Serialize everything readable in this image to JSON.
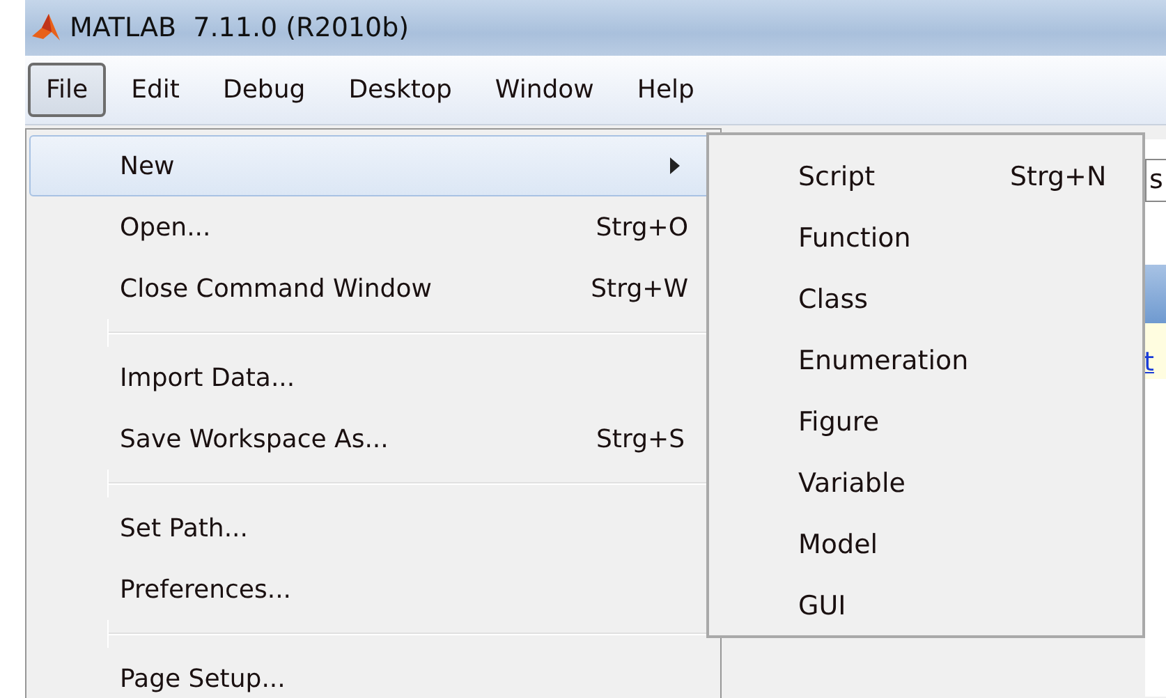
{
  "window": {
    "title": "MATLAB  7.11.0 (R2010b)"
  },
  "menubar": [
    {
      "label": "File",
      "selected": true
    },
    {
      "label": "Edit",
      "selected": false
    },
    {
      "label": "Debug",
      "selected": false
    },
    {
      "label": "Desktop",
      "selected": false
    },
    {
      "label": "Window",
      "selected": false
    },
    {
      "label": "Help",
      "selected": false
    }
  ],
  "file_menu": [
    {
      "kind": "item",
      "label": "New",
      "submenu": true,
      "selected": true
    },
    {
      "kind": "item",
      "label": "Open...",
      "shortcut": "Strg+O",
      "submenu": false,
      "selected": false
    },
    {
      "kind": "item",
      "label": "Close Command Window",
      "shortcut": "Strg+W",
      "submenu": false,
      "selected": false
    },
    {
      "kind": "separator"
    },
    {
      "kind": "item",
      "label": "Import Data...",
      "submenu": false,
      "selected": false
    },
    {
      "kind": "item",
      "label": "Save Workspace As...",
      "shortcut": "Strg+S",
      "submenu": false,
      "selected": false
    },
    {
      "kind": "separator"
    },
    {
      "kind": "item",
      "label": "Set Path...",
      "submenu": false,
      "selected": false
    },
    {
      "kind": "item",
      "label": "Preferences...",
      "submenu": false,
      "selected": false
    },
    {
      "kind": "separator"
    },
    {
      "kind": "item",
      "label": "Page Setup...",
      "submenu": false,
      "selected": false
    }
  ],
  "new_submenu": [
    {
      "label": "Script",
      "shortcut": "Strg+N"
    },
    {
      "label": "Function"
    },
    {
      "label": "Class"
    },
    {
      "label": "Enumeration"
    },
    {
      "label": "Figure"
    },
    {
      "label": "Variable"
    },
    {
      "label": "Model"
    },
    {
      "label": "GUI"
    }
  ],
  "background": {
    "field_text": "s",
    "link_text": "t"
  }
}
